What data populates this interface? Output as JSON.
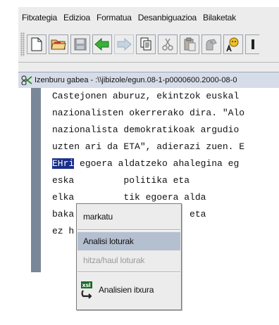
{
  "menubar": {
    "items": [
      "Fitxategia",
      "Edizioa",
      "Formatua",
      "Desanbiguazioa",
      "Bilaketak"
    ]
  },
  "toolbar": {
    "buttons": [
      {
        "icon": "new-document-icon"
      },
      {
        "icon": "open-folder-icon"
      },
      {
        "icon": "save-icon"
      },
      {
        "icon": "back-arrow-icon"
      },
      {
        "icon": "forward-arrow-icon"
      },
      {
        "icon": "copy-icon"
      },
      {
        "icon": "cut-icon"
      },
      {
        "icon": "paste-icon"
      },
      {
        "icon": "analysis-icon"
      },
      {
        "icon": "spell-check-icon"
      }
    ],
    "colors": {
      "arrow_green": "#3ab03a",
      "arrow_disabled": "#b8c8d8"
    }
  },
  "document": {
    "title": "Izenburu gabea - :\\\\jibizole/egun.08-1-p0000600.2000-08-0",
    "lines": [
      {
        "text": "Castejonen aburuz, ekintzok euskal"
      },
      {
        "text": "nazionalisten okerrerako dira. \"Alo"
      },
      {
        "text": "nazionalista demokratikoak argudio"
      },
      {
        "text": "uzten ari da ETA\", adierazi zuen. E"
      },
      {
        "selected": "EHri",
        "rest": " egoera aldatzeko ahalegina eg"
      },
      {
        "text": "eska         politika eta"
      },
      {
        "text": "elka         tik egoera alda"
      },
      {
        "text": "baka         rrera doaz, eta"
      },
      {
        "text": "ez h         zuen."
      }
    ],
    "colors": {
      "selection_bg": "#1a2f8c",
      "title_bg": "#d6dde8"
    }
  },
  "context_menu": {
    "items": [
      {
        "label": "markatu",
        "state": "normal"
      },
      {
        "label": "Analisi loturak",
        "state": "highlighted"
      },
      {
        "label": "hitza/haul loturak",
        "state": "disabled"
      },
      {
        "label": "Analisien itxura",
        "state": "normal",
        "icon": "xsl-icon"
      }
    ],
    "icon_label": "xsl"
  }
}
